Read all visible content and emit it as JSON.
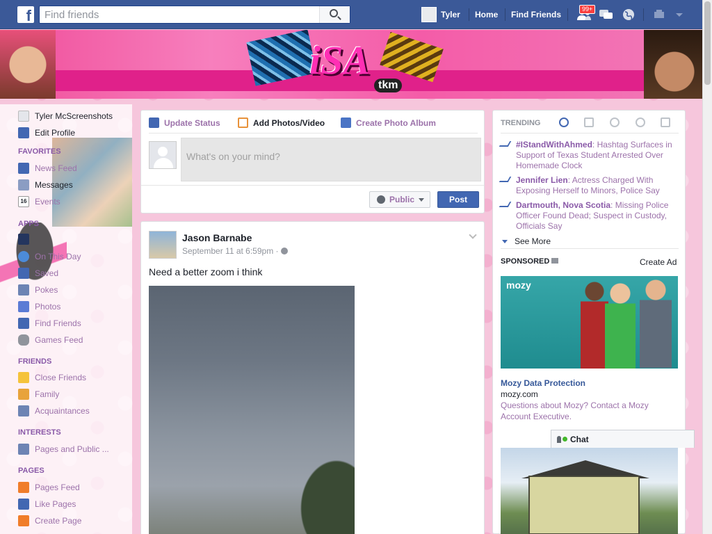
{
  "topbar": {
    "logo": "f",
    "search_placeholder": "Find friends",
    "user_name": "Tyler",
    "home_label": "Home",
    "find_friends_label": "Find Friends",
    "friend_requests_badge": "99+"
  },
  "cover": {
    "logo_text": "iSA",
    "logo_sub": "tkm"
  },
  "left_nav": {
    "profile_name": "Tyler McScreenshots",
    "edit_profile": "Edit Profile",
    "favorites_header": "FAVORITES",
    "favorites": [
      "News Feed",
      "Messages",
      "Events"
    ],
    "apps_header": "APPS",
    "apps": [
      "On This Day",
      "Saved",
      "Pokes",
      "Photos",
      "Find Friends",
      "Games Feed"
    ],
    "friends_header": "FRIENDS",
    "friends": [
      "Close Friends",
      "Family",
      "Acquaintances"
    ],
    "interests_header": "INTERESTS",
    "interests": [
      "Pages and Public ..."
    ],
    "pages_header": "PAGES",
    "pages": [
      "Pages Feed",
      "Like Pages",
      "Create Page"
    ],
    "events_icon_number": "16"
  },
  "composer": {
    "tab_update_status": "Update Status",
    "tab_add_photos": "Add Photos/Video",
    "tab_create_album": "Create Photo Album",
    "placeholder": "What's on your mind?",
    "privacy": "Public",
    "post_button": "Post"
  },
  "story": {
    "author": "Jason Barnabe",
    "timestamp": "September 11 at 6:59pm ·",
    "text": "Need a better zoom i think"
  },
  "trending": {
    "header": "TRENDING",
    "items": [
      {
        "title": "#IStandWithAhmed",
        "desc": ": Hashtag Surfaces in Support of Texas Student Arrested Over Homemade Clock"
      },
      {
        "title": "Jennifer Lien",
        "desc": ": Actress Charged With Exposing Herself to Minors, Police Say"
      },
      {
        "title": "Dartmouth, Nova Scotia",
        "desc": ": Missing Police Officer Found Dead; Suspect in Custody, Officials Say"
      }
    ],
    "see_more": "See More"
  },
  "sponsored": {
    "header": "SPONSORED",
    "create_ad": "Create Ad",
    "ad1_brand": "mozy",
    "ad1_title": "Mozy Data Protection",
    "ad1_url": "mozy.com",
    "ad1_desc": "Questions about Mozy? Contact a Mozy Account Executive."
  },
  "chat": {
    "label": "Chat"
  },
  "colors": {
    "facebook_blue": "#3b5998",
    "link_purple": "#9c72aa",
    "post_button": "#4267b2",
    "badge_red": "#fa3e3e"
  }
}
